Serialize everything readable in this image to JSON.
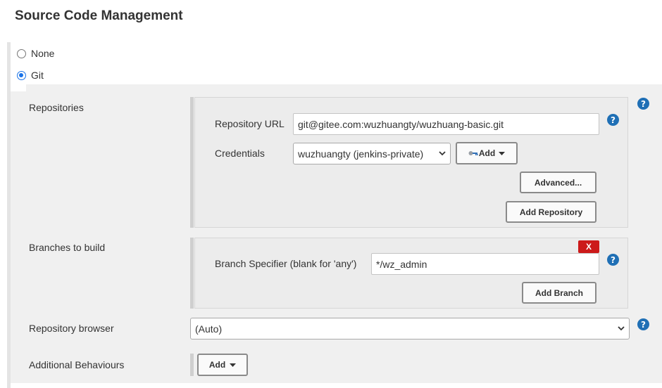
{
  "section": {
    "title": "Source Code Management",
    "options": [
      {
        "label": "None",
        "checked": false
      },
      {
        "label": "Git",
        "checked": true
      }
    ]
  },
  "repositories": {
    "label": "Repositories",
    "url_label": "Repository URL",
    "url_value": "git@gitee.com:wuzhuangty/wuzhuang-basic.git",
    "credentials_label": "Credentials",
    "credentials_value": "wuzhuangty (jenkins-private)",
    "add_label": "Add",
    "advanced_label": "Advanced...",
    "add_repository_label": "Add Repository"
  },
  "branches": {
    "label": "Branches to build",
    "delete_label": "X",
    "specifier_label": "Branch Specifier (blank for 'any')",
    "specifier_value": "*/wz_admin",
    "add_branch_label": "Add Branch"
  },
  "browser": {
    "label": "Repository browser",
    "value": "(Auto)"
  },
  "behaviours": {
    "label": "Additional Behaviours",
    "add_label": "Add"
  },
  "help_glyph": "?",
  "colors": {
    "help": "#1f6fb5",
    "radio_checked": "#1a73e8",
    "delete": "#cc1a1a"
  }
}
